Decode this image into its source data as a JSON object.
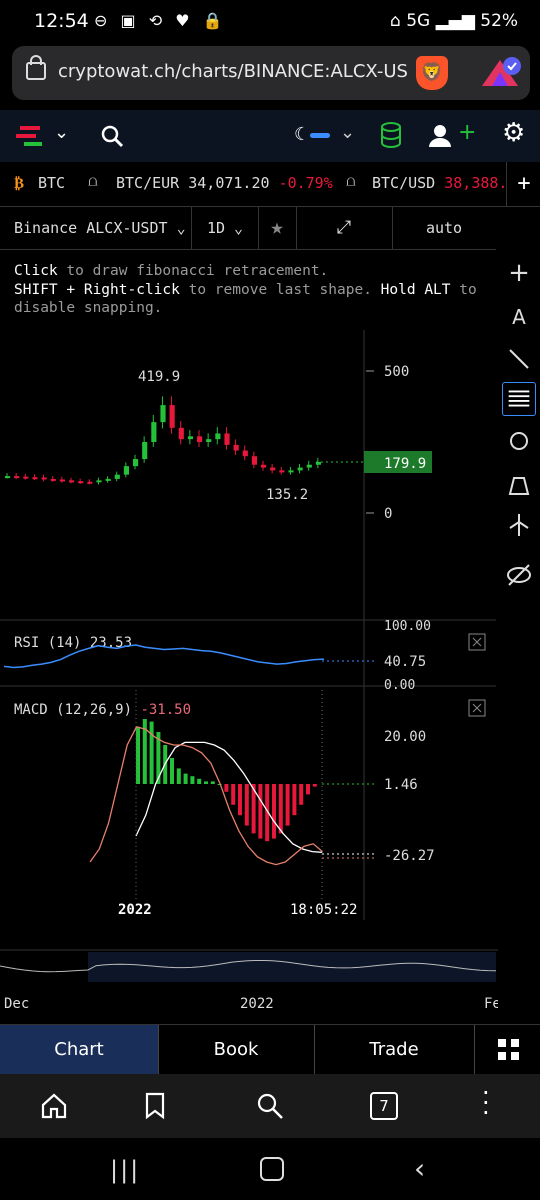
{
  "status": {
    "time": "12:54",
    "network": "5G",
    "battery": "52%"
  },
  "browser": {
    "url": "cryptowat.ch/charts/BINANCE:ALCX-USDT?pe",
    "tab_count": "7"
  },
  "ticker": {
    "items": [
      {
        "symbol": "BTC"
      },
      {
        "symbol": "BTC/EUR",
        "price": "34,071.20",
        "change": "-0.79%"
      },
      {
        "symbol": "BTC/USD",
        "price": "38,388."
      }
    ],
    "add": "+"
  },
  "toolbar": {
    "market": "Binance ALCX-USDT",
    "interval": "1D",
    "scale": "auto"
  },
  "hint": {
    "line1_key": "Click",
    "line1_rest": " to draw fibonacci retracement.",
    "line2_key": "SHIFT + Right-click",
    "line2_rest": " to remove last shape.",
    "line2_key2": "Hold ALT",
    "line2_rest2": " to",
    "line3": "disable snapping."
  },
  "chart_data": [
    {
      "type": "candlestick",
      "title": "Binance ALCX-USDT",
      "y_ticks": [
        500,
        0
      ],
      "high_label": "419.9",
      "low_label": "135.2",
      "last_price": "179.9",
      "closes": [
        130,
        128,
        126,
        125,
        120,
        118,
        115,
        112,
        110,
        108,
        115,
        120,
        135,
        165,
        190,
        250,
        320,
        380,
        300,
        260,
        270,
        250,
        260,
        280,
        240,
        220,
        200,
        170,
        160,
        150,
        145,
        150,
        160,
        170,
        179.9
      ],
      "colors": {
        "up": "#26c13a",
        "down": "#e8183c"
      }
    },
    {
      "type": "line",
      "name": "RSI (14)",
      "value": "23.53",
      "y_ticks": [
        "100.00",
        "0.00"
      ],
      "last_label": "40.75",
      "values": [
        28,
        26,
        27,
        30,
        32,
        35,
        40,
        48,
        55,
        60,
        65,
        62,
        60,
        64,
        66,
        62,
        60,
        58,
        59,
        60,
        58,
        56,
        55,
        52,
        48,
        44,
        40,
        36,
        34,
        32,
        33,
        36,
        38,
        40,
        40.75
      ]
    },
    {
      "type": "macd",
      "name": "MACD (12,26,9)",
      "value": "-31.50",
      "y_ticks": [
        "20.00",
        "1.46",
        "-26.27"
      ],
      "hist": [
        22,
        25,
        24,
        20,
        15,
        10,
        6,
        4,
        3,
        2,
        1,
        1,
        0,
        -3,
        -8,
        -12,
        -16,
        -19,
        -21,
        -22,
        -21,
        -19,
        -16,
        -12,
        -8,
        -4,
        -1
      ],
      "macd": [
        -30,
        -25,
        -15,
        0,
        15,
        22,
        21,
        18,
        16,
        15,
        15,
        14,
        12,
        8,
        0,
        -10,
        -18,
        -24,
        -28,
        -30,
        -31,
        -30,
        -27,
        -24,
        -23,
        -26
      ],
      "signal": [
        -20,
        -12,
        0,
        8,
        14,
        16,
        16,
        16,
        15,
        13,
        9,
        4,
        -2,
        -8,
        -14,
        -19,
        -23,
        -25,
        -26,
        -26.27
      ],
      "time_labels": [
        "2022",
        "18:05:22"
      ]
    }
  ],
  "navigator": {
    "labels": [
      "Dec",
      "2022",
      "Fe"
    ]
  },
  "tabs": [
    "Chart",
    "Book",
    "Trade"
  ]
}
